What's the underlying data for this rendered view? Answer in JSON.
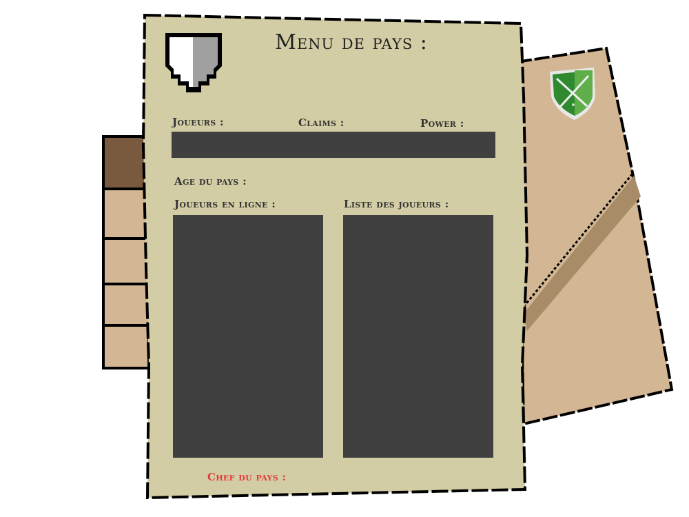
{
  "menu": {
    "title": "Menu de pays :"
  },
  "stats": {
    "players_label": "Joueurs :",
    "claims_label": "Claims :",
    "power_label": "Power :"
  },
  "info": {
    "age_label": "Age du pays :",
    "online_label": "Joueurs en ligne :",
    "list_label": "Liste des joueurs :",
    "chief_label": "Chef du pays :"
  },
  "icons": {
    "country_shield": "shield-icon",
    "folder_emblem": "crossed-swords-shield-icon"
  },
  "colors": {
    "parchment": "#d3cda5",
    "panel": "#404040",
    "tab": "#d3b693",
    "tab_active": "#7a5a3e",
    "chief_label": "#e23c3c",
    "emblem_green": "#2f8a2f"
  },
  "tabs": [
    {
      "active": true
    },
    {
      "active": false
    },
    {
      "active": false
    },
    {
      "active": false
    },
    {
      "active": false
    }
  ]
}
